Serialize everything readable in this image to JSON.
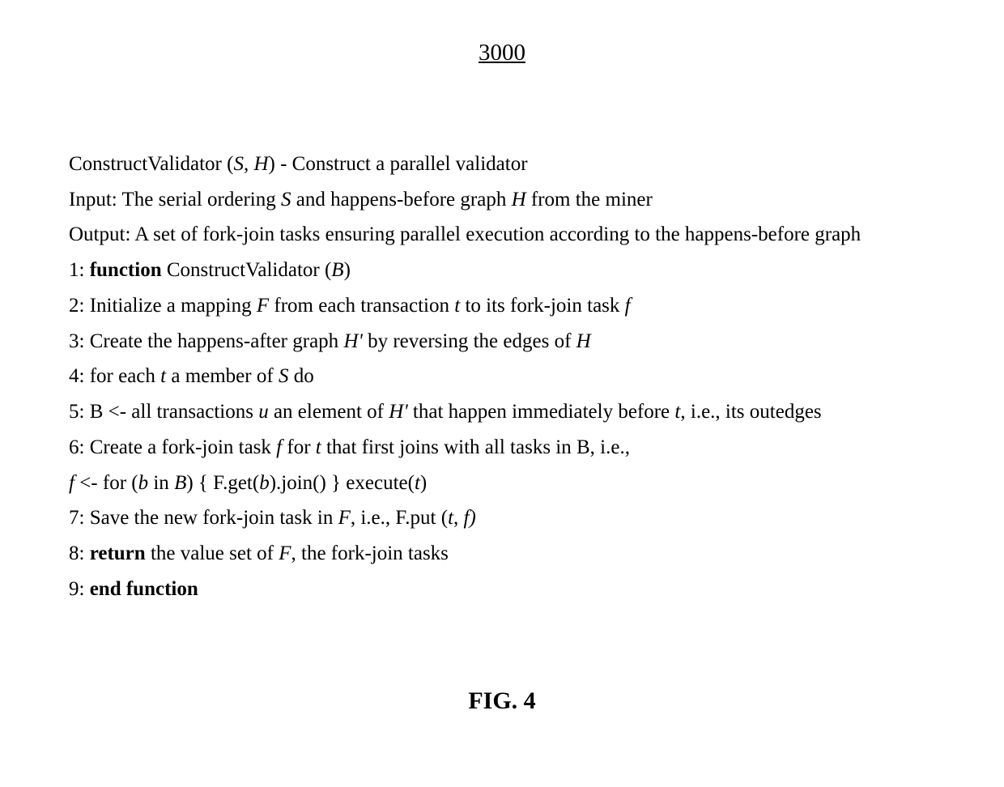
{
  "figure_number": "3000",
  "header": {
    "name_prefix": "ConstructValidator (",
    "name_args_S": "S",
    "name_args_sep": ", ",
    "name_args_H": "H",
    "name_suffix": ") - Construct a parallel validator",
    "input_label": "Input: The serial ordering ",
    "input_S": "S",
    "input_mid": " and happens-before graph ",
    "input_H": "H",
    "input_end": " from the miner",
    "output": "Output: A set of fork-join tasks ensuring parallel execution according to the happens-before graph"
  },
  "lines": {
    "l1_num": "1: ",
    "l1_function": "function",
    "l1_rest": " ConstructValidator (",
    "l1_B": "B",
    "l1_close": ")",
    "l2_prefix": "2: Initialize a mapping ",
    "l2_F": "F",
    "l2_mid1": " from each transaction ",
    "l2_t": "t",
    "l2_mid2": " to its fork-join task ",
    "l2_f": "f",
    "l3_prefix": "3: Create the happens-after graph ",
    "l3_H": "H'",
    "l3_mid": " by reversing the edges of ",
    "l3_H2": "H",
    "l4_prefix": "4: for each ",
    "l4_t": "t",
    "l4_mid": " a member of ",
    "l4_S": "S",
    "l4_end": " do",
    "l5_prefix": "5: B <- all transactions ",
    "l5_u": "u",
    "l5_mid1": " an element of ",
    "l5_H": "H'",
    "l5_mid2": " that happen immediately before ",
    "l5_t": "t",
    "l5_end": ", i.e., its outedges",
    "l6_prefix": "6: Create a fork-join task ",
    "l6_f": "f",
    "l6_mid1": " for ",
    "l6_t": "t",
    "l6_end": " that first joins with all tasks in B, i.e.,",
    "l6b_f": "f",
    "l6b_mid1": " <- for (",
    "l6b_b": "b",
    "l6b_mid2": " in ",
    "l6b_B": "B",
    "l6b_mid3": ") { F.get(",
    "l6b_b2": "b",
    "l6b_mid4": ").join() } execute(",
    "l6b_t": "t",
    "l6b_close": ")",
    "l7_prefix": "7: Save the new fork-join task in ",
    "l7_F": "F",
    "l7_mid": ", i.e., F.put (",
    "l7_t": "t",
    "l7_sep": ", ",
    "l7_f": "f)",
    "l8_num": "8: ",
    "l8_return": "return",
    "l8_mid": " the value set of ",
    "l8_F": "F",
    "l8_end": ", the fork-join tasks",
    "l9_num": "9: ",
    "l9_end": "end function"
  },
  "caption": "FIG. 4"
}
